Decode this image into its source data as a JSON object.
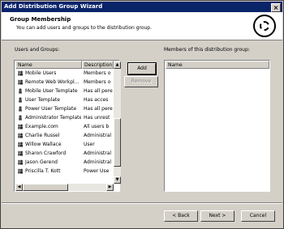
{
  "window": {
    "title": "Add Distribution Group Wizard",
    "close_symbol": "×"
  },
  "header": {
    "title": "Group Membership",
    "subtitle": "You can add users and groups to the distribution group.",
    "icon": "wizard-emblem-icon"
  },
  "left": {
    "label": "Users and Groups:",
    "columns": {
      "name": "Name",
      "description": "Description ▲"
    },
    "rows": [
      {
        "name": "Mobile Users",
        "desc": "Members o",
        "icon": "group-icon"
      },
      {
        "name": "Remote Web Workpl...",
        "desc": "Members o",
        "icon": "group-icon"
      },
      {
        "name": "Mobile User Template",
        "desc": "Has all pere",
        "icon": "user-icon"
      },
      {
        "name": "User Template",
        "desc": "Has acces",
        "icon": "user-icon"
      },
      {
        "name": "Power User Template",
        "desc": "Has all pere",
        "icon": "user-icon"
      },
      {
        "name": "Administrator Template",
        "desc": "Has unrest",
        "icon": "user-icon"
      },
      {
        "name": "Example.com",
        "desc": "All users b",
        "icon": "group-icon"
      },
      {
        "name": "Charlie Russel",
        "desc": "Administral",
        "icon": "group-icon"
      },
      {
        "name": "Willow Wallace",
        "desc": "User",
        "icon": "group-icon"
      },
      {
        "name": "Sharon Crawford",
        "desc": "Administral",
        "icon": "group-icon"
      },
      {
        "name": "Jason Gerend",
        "desc": "Administral",
        "icon": "group-icon"
      },
      {
        "name": "Priscilla T. Kott",
        "desc": "Power Use",
        "icon": "group-icon"
      }
    ]
  },
  "middle": {
    "add": "Add",
    "remove": "Remove"
  },
  "right": {
    "label": "Members of this distribution group:",
    "column": "Name"
  },
  "footer": {
    "back": "< Back",
    "next": "Next >",
    "cancel": "Cancel"
  }
}
